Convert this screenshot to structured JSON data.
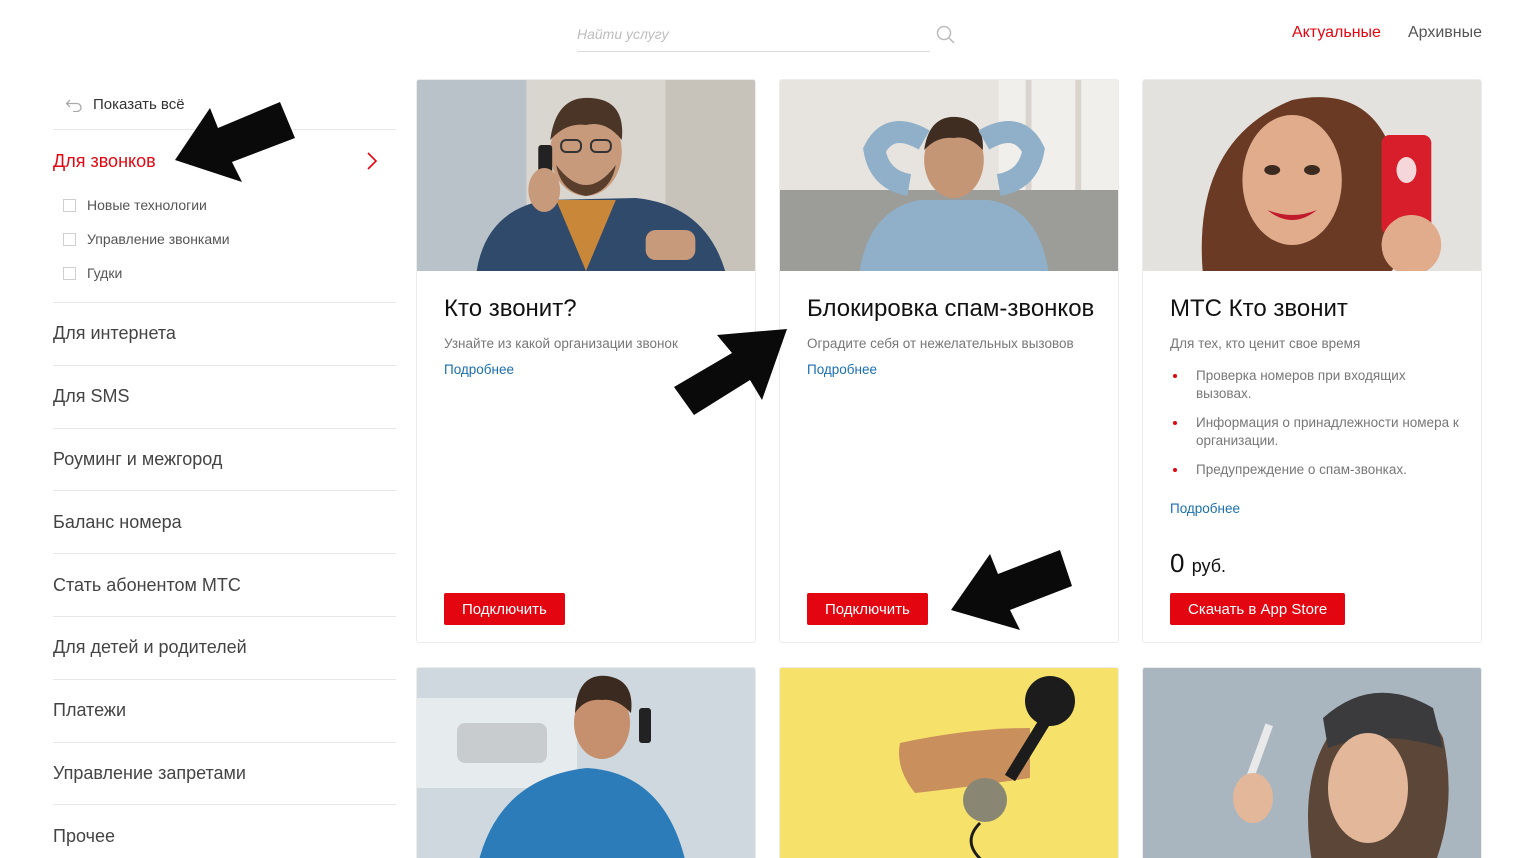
{
  "search": {
    "placeholder": "Найти услугу"
  },
  "tabs": [
    {
      "label": "Актуальные"
    },
    {
      "label": "Архивные"
    }
  ],
  "sidebar": {
    "show_all": "Показать всё",
    "active_category": "Для звонков",
    "subcategories": [
      {
        "label": "Новые технологии"
      },
      {
        "label": "Управление звонками"
      },
      {
        "label": "Гудки"
      }
    ],
    "categories": [
      {
        "label": "Для интернета"
      },
      {
        "label": "Для SMS"
      },
      {
        "label": "Роуминг и межгород"
      },
      {
        "label": "Баланс номера"
      },
      {
        "label": "Стать абонентом МТС"
      },
      {
        "label": "Для детей и родителей"
      },
      {
        "label": "Платежи"
      },
      {
        "label": "Управление запретами"
      },
      {
        "label": "Прочее"
      }
    ]
  },
  "cards": [
    {
      "title": "Кто звонит?",
      "description": "Узнайте из какой организации звонок",
      "more": "Подробнее",
      "button": "Подключить"
    },
    {
      "title": "Блокировка спам-звонков",
      "description": "Оградите себя от нежелательных вызовов",
      "more": "Подробнее",
      "button": "Подключить"
    },
    {
      "title": "МТС Кто звонит",
      "description": "Для тех, кто ценит свое время",
      "features": [
        "Проверка номеров при входящих вызовах.",
        "Информация о принадлежности номера к организации.",
        "Предупреждение о спам-звонках."
      ],
      "more": "Подробнее",
      "price_value": "0",
      "price_currency": "руб.",
      "button": "Скачать в App Store"
    }
  ],
  "colors": {
    "accent": "#e30611",
    "link": "#1a6fb0"
  }
}
